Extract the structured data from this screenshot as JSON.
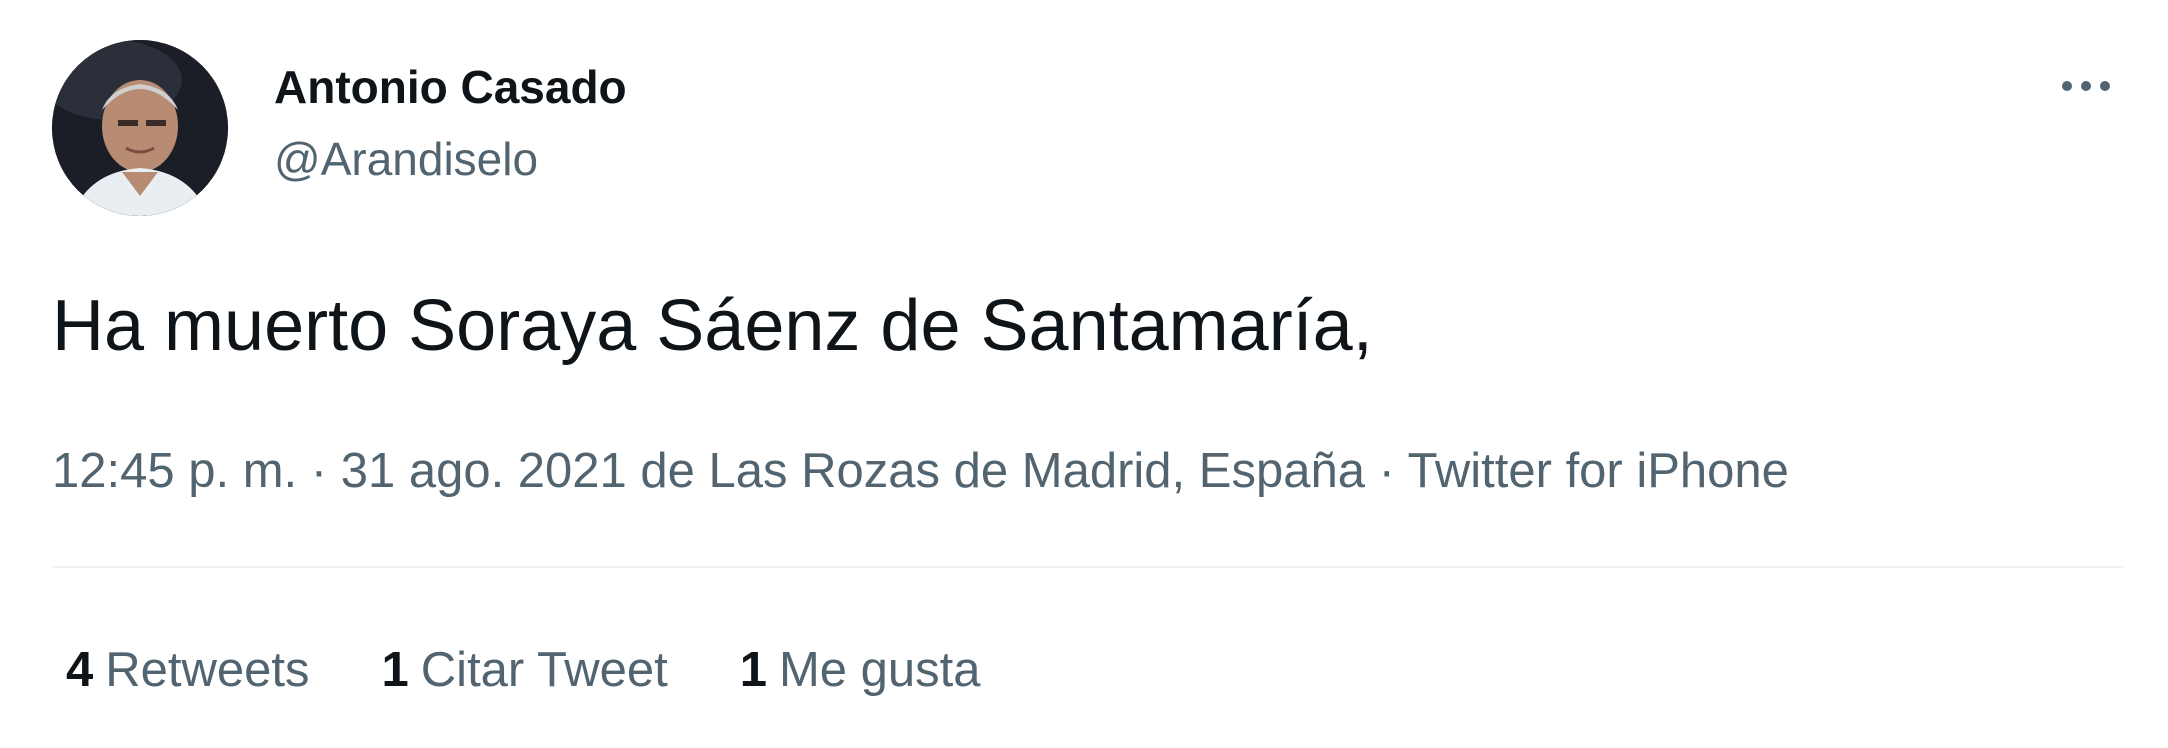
{
  "author": {
    "display_name": "Antonio Casado",
    "handle": "@Arandiselo"
  },
  "tweet": {
    "text": "Ha muerto Soraya Sáenz de Santamaría,"
  },
  "meta": {
    "time": "12:45 p. m.",
    "separator_1": " · ",
    "date": "31 ago. 2021",
    "location": " de Las Rozas de Madrid, España",
    "separator_2": " · ",
    "source": "Twitter for iPhone"
  },
  "stats": {
    "retweets_count": "4",
    "retweets_label": "Retweets",
    "quotes_count": "1",
    "quotes_label": "Citar Tweet",
    "likes_count": "1",
    "likes_label": "Me gusta"
  },
  "icons": {
    "more": "more-horizontal-icon"
  },
  "colors": {
    "text_primary": "#0f1419",
    "text_secondary": "#536471",
    "divider": "#eff3f4"
  }
}
